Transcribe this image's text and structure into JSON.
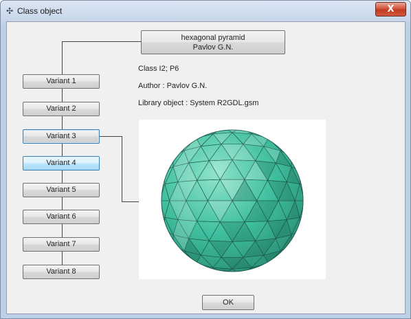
{
  "window": {
    "title": "Class object",
    "close_label": "X"
  },
  "header_button": {
    "line1": "hexagonal pyramid",
    "line2": "Pavlov G.N."
  },
  "variants": [
    "Variant 1",
    "Variant 2",
    "Variant 3",
    "Variant 4",
    "Variant 5",
    "Variant 6",
    "Variant 7",
    "Variant 8"
  ],
  "info": {
    "class": "Class I2; P6",
    "author": "Author : Pavlov G.N.",
    "library": "Library object : System R2GDL.gsm"
  },
  "ok_label": "OK",
  "colors": {
    "sphere": "#3fbf9f",
    "sphere_dark": "#2a8f76",
    "sphere_light": "#8fe3cb"
  },
  "icons": {
    "app": "class-object-icon",
    "close": "close-icon"
  }
}
